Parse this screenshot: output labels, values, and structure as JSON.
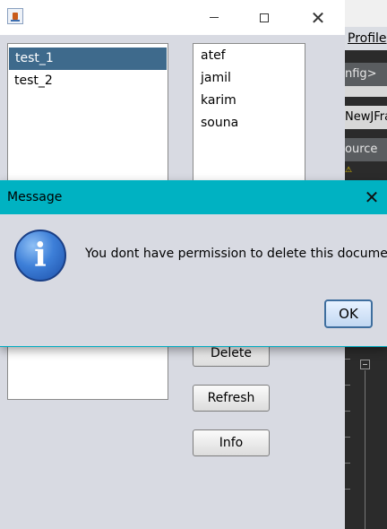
{
  "ide": {
    "menu_label": "Profile",
    "toolbar": [
      "nfig>",
      "",
      "NewJFra",
      "ource"
    ]
  },
  "window": {
    "left_list": [
      "test_1",
      "test_2"
    ],
    "selected_left": "test_1",
    "right_list": [
      "atef",
      "jamil",
      "karim",
      "souna"
    ],
    "buttons": {
      "delete": "Delete",
      "refresh": "Refresh",
      "info": "Info"
    }
  },
  "dialog": {
    "title": "Message",
    "message": "You dont have permission to delete this document",
    "ok_label": "OK",
    "icon": "info-icon"
  },
  "colors": {
    "dialog_titlebar": "#00b2c2",
    "selection": "#3e6a8c",
    "window_bg": "#d8dae2"
  }
}
